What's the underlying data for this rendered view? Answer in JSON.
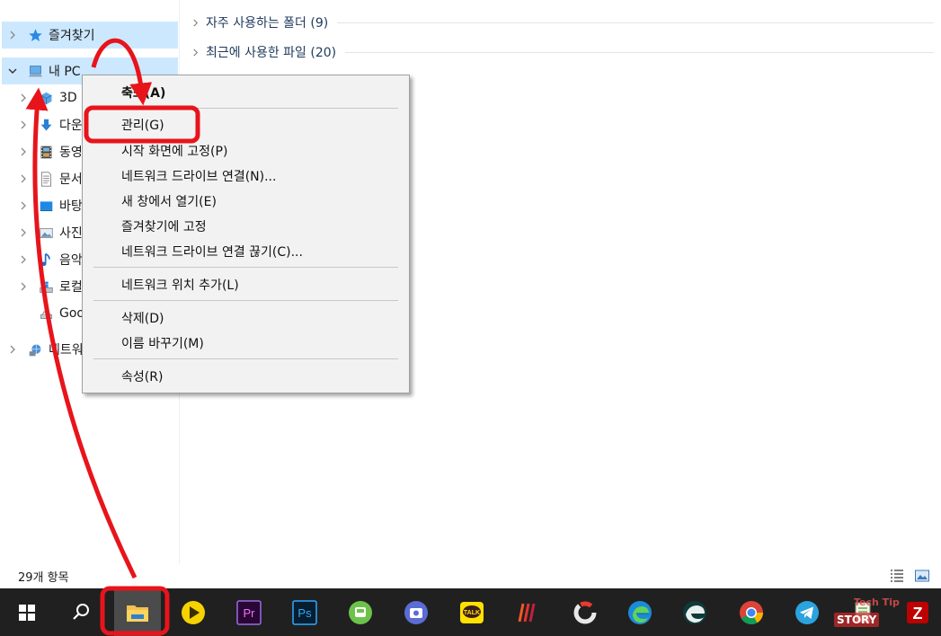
{
  "nav": {
    "items": [
      {
        "label": "즐겨찾기"
      },
      {
        "label": "내 PC"
      },
      {
        "label": "3D"
      },
      {
        "label": "다운"
      },
      {
        "label": "동영"
      },
      {
        "label": "문서"
      },
      {
        "label": "바탕"
      },
      {
        "label": "사진"
      },
      {
        "label": "음악"
      },
      {
        "label": "로컬"
      },
      {
        "label": "Goo"
      },
      {
        "label": "네트워"
      }
    ]
  },
  "content": {
    "groups": [
      {
        "label": "자주 사용하는 폴더 (9)"
      },
      {
        "label": "최근에 사용한 파일 (20)"
      }
    ]
  },
  "context_menu": {
    "items": [
      {
        "label": "축소(A)"
      },
      {
        "label": "관리(G)"
      },
      {
        "label": "시작 화면에 고정(P)"
      },
      {
        "label": "네트워크 드라이브 연결(N)..."
      },
      {
        "label": "새 창에서 열기(E)"
      },
      {
        "label": "즐겨찾기에 고정"
      },
      {
        "label": "네트워크 드라이브 연결 끊기(C)..."
      },
      {
        "label": "네트워크 위치 추가(L)"
      },
      {
        "label": "삭제(D)"
      },
      {
        "label": "이름 바꾸기(M)"
      },
      {
        "label": "속성(R)"
      }
    ]
  },
  "status": {
    "item_count": "29개 항목"
  },
  "taskbar": {
    "apps": [
      "start-icon",
      "search-icon",
      "file-explorer-icon",
      "media-player-icon",
      "premiere-pro-icon",
      "photoshop-icon",
      "bus-app-icon",
      "camera-app-icon",
      "kakaotalk-icon",
      "music-app-icon",
      "loading-app-icon",
      "edge-icon",
      "edge-dev-icon",
      "chrome-icon",
      "telegram-icon",
      "notepad-icon",
      "filezilla-icon"
    ],
    "labels": {
      "premiere": "Pr",
      "photoshop": "Ps",
      "kakao": "TALK",
      "filezilla": "Z"
    }
  },
  "watermark": {
    "top": "Tech Tip",
    "bottom": "STORY"
  },
  "colors": {
    "selection": "#cce8ff",
    "annotation": "#e8141b",
    "taskbar": "#202020",
    "accent": "#76b9ed"
  }
}
